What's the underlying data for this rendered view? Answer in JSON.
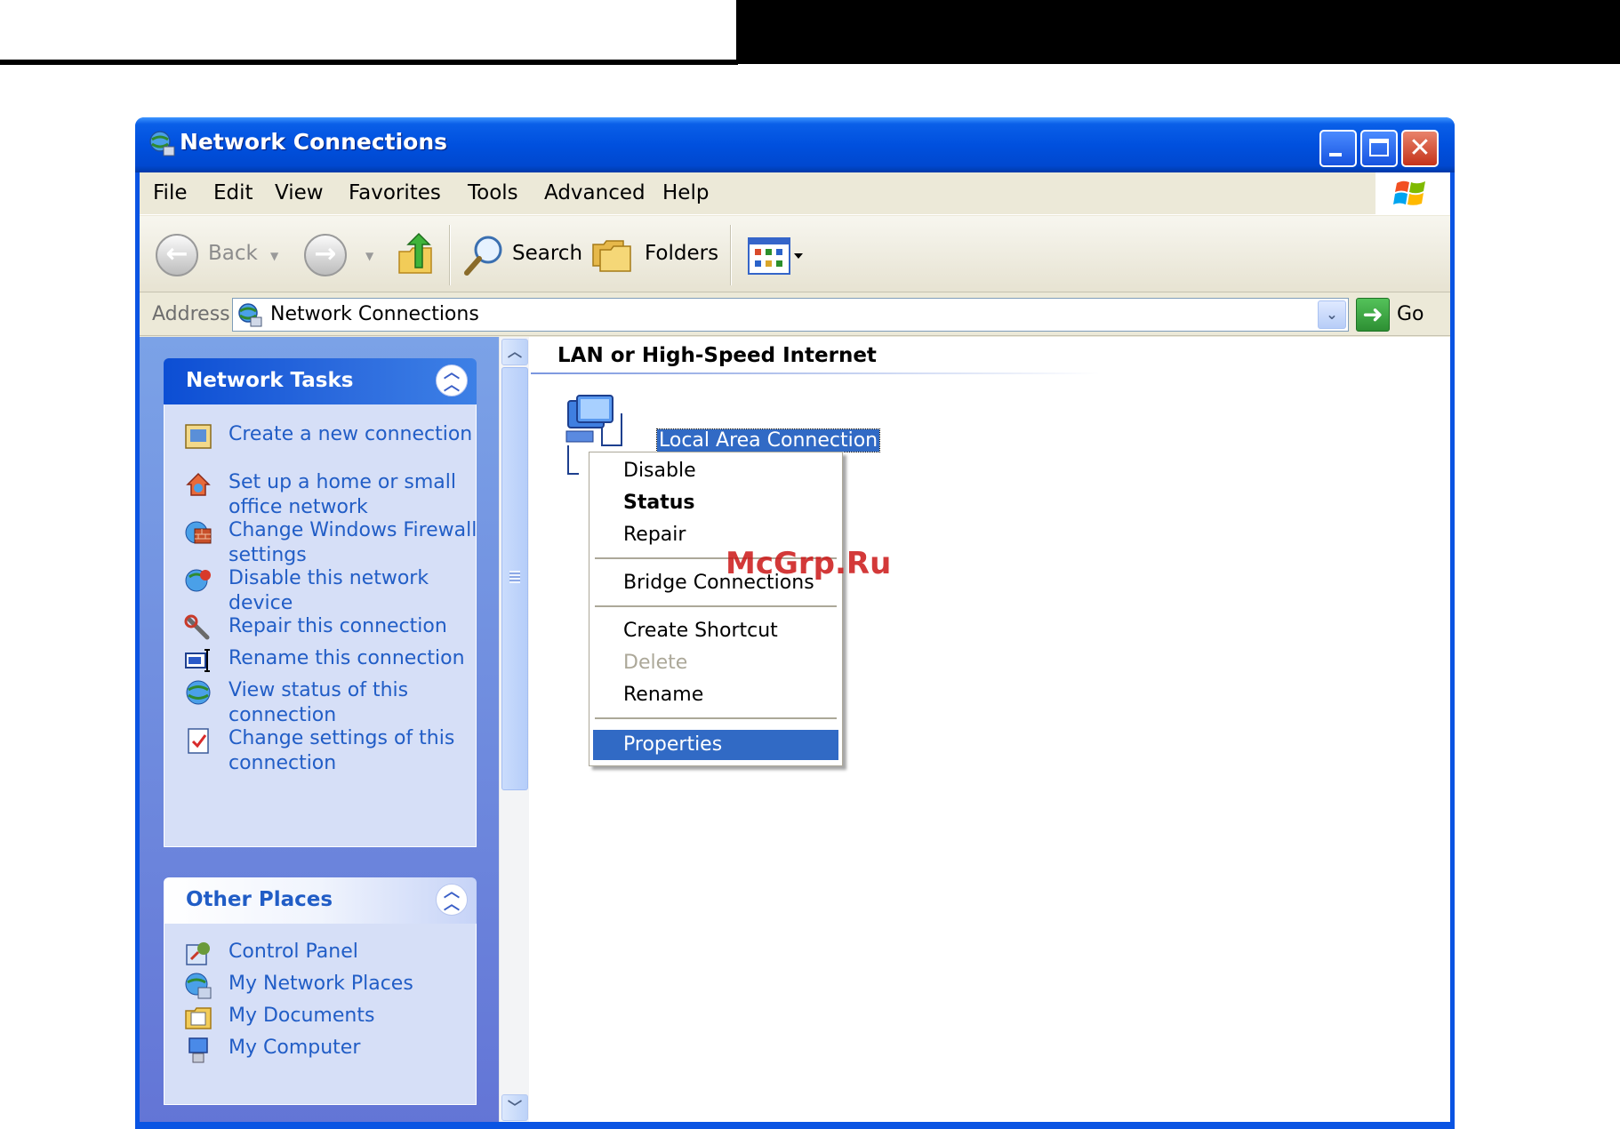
{
  "window": {
    "title": "Network Connections",
    "colors": {
      "titlebar": "#0050de",
      "selection": "#316ac5",
      "task_link": "#215dc6"
    }
  },
  "menubar": {
    "items": [
      "File",
      "Edit",
      "View",
      "Favorites",
      "Tools",
      "Advanced",
      "Help"
    ]
  },
  "toolbar": {
    "back_label": "Back",
    "search_label": "Search",
    "folders_label": "Folders"
  },
  "address": {
    "label": "Address",
    "value": "Network Connections",
    "go_label": "Go"
  },
  "taskpane": {
    "network_tasks": {
      "title": "Network Tasks",
      "items": [
        {
          "label": "Create a new connection",
          "icon": "new-connection-icon"
        },
        {
          "label": "Set up a home or small office network",
          "icon": "home-network-icon"
        },
        {
          "label": "Change Windows Firewall settings",
          "icon": "firewall-icon"
        },
        {
          "label": "Disable this network device",
          "icon": "disable-network-icon"
        },
        {
          "label": "Repair this connection",
          "icon": "repair-icon"
        },
        {
          "label": "Rename this connection",
          "icon": "rename-icon"
        },
        {
          "label": "View status of this connection",
          "icon": "status-icon"
        },
        {
          "label": "Change settings of this connection",
          "icon": "settings-icon"
        }
      ]
    },
    "other_places": {
      "title": "Other Places",
      "items": [
        {
          "label": "Control Panel",
          "icon": "control-panel-icon"
        },
        {
          "label": "My Network Places",
          "icon": "network-places-icon"
        },
        {
          "label": "My Documents",
          "icon": "documents-icon"
        },
        {
          "label": "My Computer",
          "icon": "computer-icon"
        }
      ]
    }
  },
  "content": {
    "group_title": "LAN or High-Speed Internet",
    "connection_label": "Local Area Connection"
  },
  "context_menu": {
    "items": [
      {
        "label": "Disable",
        "state": "normal"
      },
      {
        "label": "Status",
        "state": "default"
      },
      {
        "label": "Repair",
        "state": "normal"
      },
      {
        "label": "Bridge Connections",
        "state": "normal"
      },
      {
        "label": "Create Shortcut",
        "state": "normal"
      },
      {
        "label": "Delete",
        "state": "disabled"
      },
      {
        "label": "Rename",
        "state": "normal"
      },
      {
        "label": "Properties",
        "state": "selected"
      }
    ]
  },
  "watermark": "McGrp.Ru"
}
